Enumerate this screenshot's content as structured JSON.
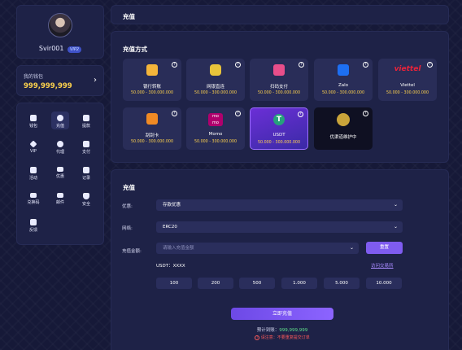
{
  "profile": {
    "username": "Svir001",
    "vip": "VIP2"
  },
  "wallet": {
    "label": "我的钱包",
    "amount": "999,999,999"
  },
  "menu": [
    {
      "label": "钱包",
      "icon": "wallet-icon"
    },
    {
      "label": "充值",
      "icon": "deposit-icon",
      "active": true
    },
    {
      "label": "提款",
      "icon": "withdraw-icon"
    },
    {
      "label": "VIP",
      "icon": "diamond-icon"
    },
    {
      "label": "代理",
      "icon": "agent-icon"
    },
    {
      "label": "支付",
      "icon": "pay-icon"
    },
    {
      "label": "活动",
      "icon": "event-icon"
    },
    {
      "label": "优惠",
      "icon": "ticket-icon"
    },
    {
      "label": "记录",
      "icon": "record-icon"
    },
    {
      "label": "兑换码",
      "icon": "code-icon"
    },
    {
      "label": "邮件",
      "icon": "mail-icon"
    },
    {
      "label": "安全",
      "icon": "shield-icon"
    },
    {
      "label": "反馈",
      "icon": "feedback-icon"
    }
  ],
  "header": {
    "title": "充值"
  },
  "methods": {
    "title": "充值方式",
    "items": [
      {
        "name": "银行转账",
        "range": "50.000 - 300.000.000"
      },
      {
        "name": "网银直连",
        "range": "50.000 - 300.000.000"
      },
      {
        "name": "扫码支付",
        "range": "50.000 - 300.000.000"
      },
      {
        "name": "Zalo",
        "range": "50.000 - 300.000.000"
      },
      {
        "name": "Viettel",
        "range": "50.000 - 300.000.000"
      },
      {
        "name": "刮刮卡",
        "range": "50.000 - 300.000.000"
      },
      {
        "name": "Momo",
        "range": "50.000 - 300.000.000"
      },
      {
        "name": "USDT",
        "range": "50.000 - 300.000.000",
        "selected": true
      },
      {
        "name": "优渠道维护中",
        "range": ""
      }
    ]
  },
  "deposit": {
    "title": "充值",
    "promo_label": "优惠:",
    "promo_value": "存款优惠",
    "network_label": "网络:",
    "network_value": "ERC20",
    "amount_label": "充值金额:",
    "amount_placeholder": "请输入充值金额",
    "reset_label": "重置",
    "rate": "USDT：XXXX",
    "trade_link": "访问交易所",
    "amounts": [
      "100",
      "200",
      "500",
      "1.000",
      "5.000",
      "10.000"
    ],
    "submit_label": "立即充值",
    "expected_label": "预计到账：",
    "expected_value": "999,999,999",
    "warning": "请注意：不要重复提交订单"
  },
  "colors": {
    "accent": "#7f5cf0",
    "gold": "#ffd34d",
    "panel": "#1e2247"
  }
}
